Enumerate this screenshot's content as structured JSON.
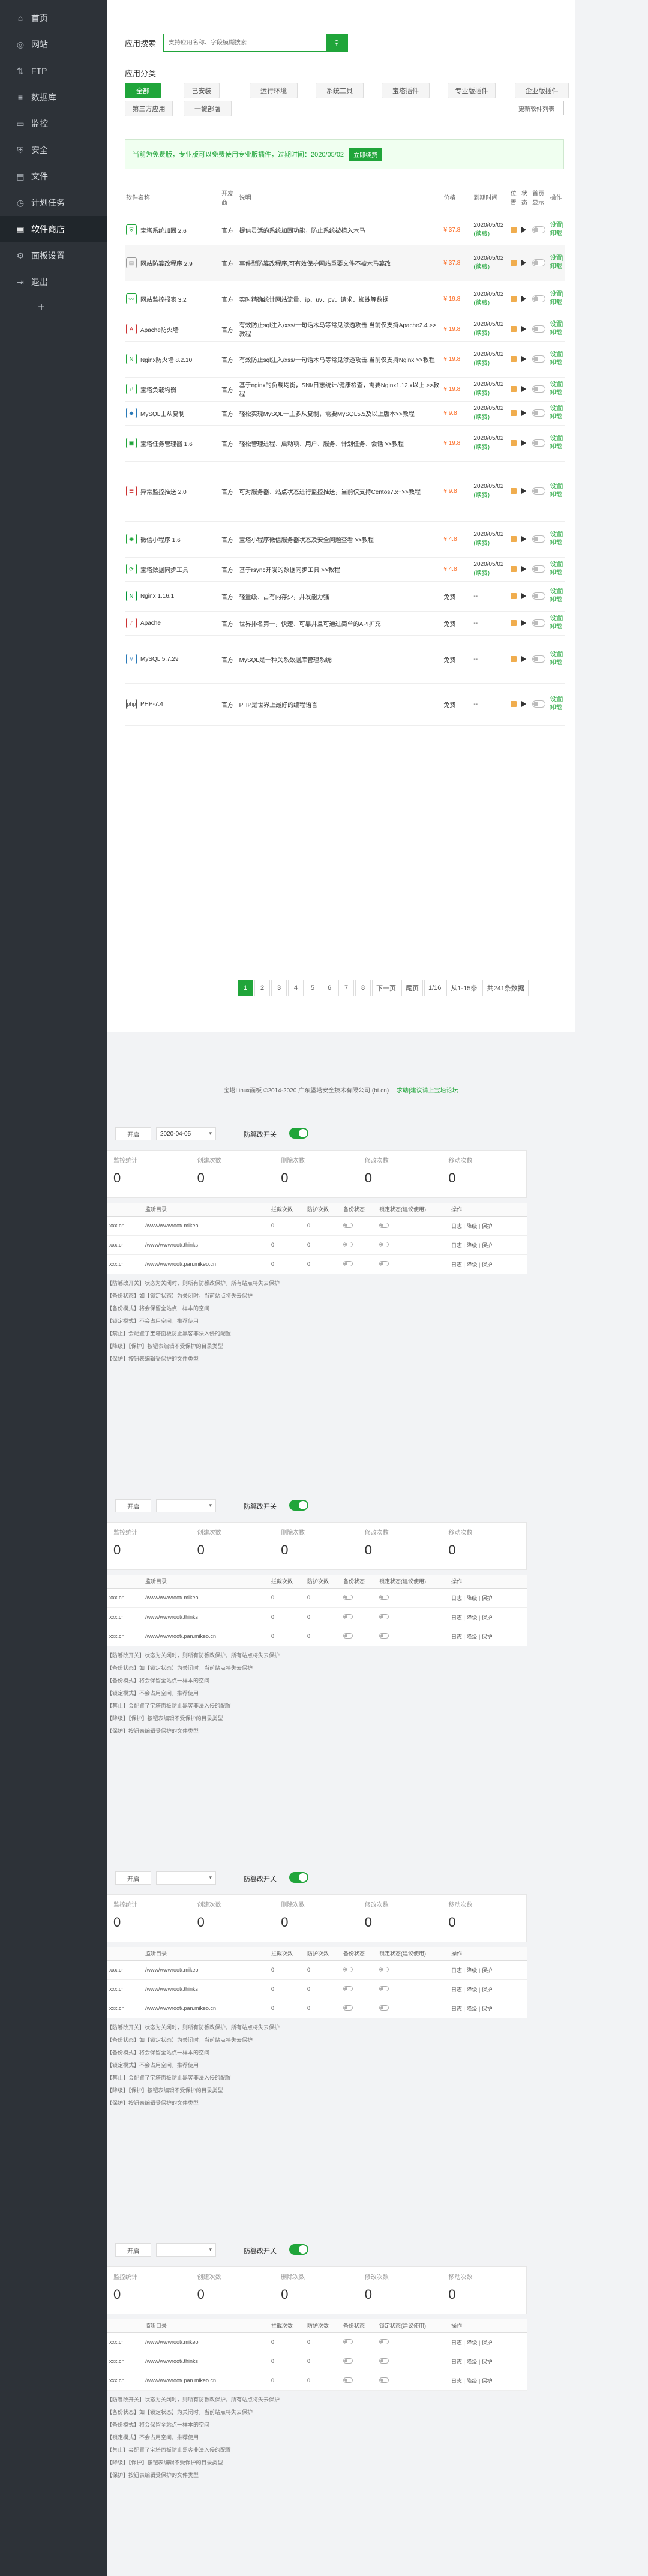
{
  "sidebar": {
    "items": [
      {
        "label": "首页",
        "icon": "home-icon"
      },
      {
        "label": "网站",
        "icon": "globe-icon"
      },
      {
        "label": "FTP",
        "icon": "ftp-icon"
      },
      {
        "label": "数据库",
        "icon": "database-icon"
      },
      {
        "label": "监控",
        "icon": "monitor-icon"
      },
      {
        "label": "安全",
        "icon": "shield-icon"
      },
      {
        "label": "文件",
        "icon": "folder-icon"
      },
      {
        "label": "计划任务",
        "icon": "clock-icon"
      },
      {
        "label": "软件商店",
        "icon": "grid-icon"
      },
      {
        "label": "面板设置",
        "icon": "gear-icon"
      },
      {
        "label": "退出",
        "icon": "logout-icon"
      }
    ],
    "add": "+"
  },
  "store": {
    "search_label": "应用搜索",
    "search_placeholder": "支持应用名称、字段模糊搜索",
    "cat_label": "应用分类",
    "categories": [
      "全部",
      "已安装",
      "运行环境",
      "系统工具",
      "宝塔插件",
      "专业版插件",
      "企业版插件",
      "第三方应用",
      "一键部署"
    ],
    "update_btn": "更新软件列表",
    "notice": "当前为免费版，专业版可以免费使用专业版插件，过期时间：2020/05/02",
    "notice_btn": "立即续费",
    "headers": [
      "软件名称",
      "开发商",
      "说明",
      "价格",
      "到期时间",
      "位置",
      "状态",
      "首页显示",
      "操作"
    ],
    "rows": [
      {
        "name": "宝塔系统加固 2.6",
        "dev": "官方",
        "desc": "提供灵活的系统加固功能，防止系统被植入木马",
        "price": "¥ 37.8",
        "date": "2020/05/02",
        "renew": "(续费)",
        "op": "设置|卸载"
      },
      {
        "name": "网站防篡改程序 2.9",
        "dev": "官方",
        "desc": "事件型防篡改程序,可有效保护网站重要文件不被木马篡改",
        "price": "¥ 37.8",
        "date": "2020/05/02",
        "renew": "(续费)",
        "op": "设置|卸载"
      },
      {
        "name": "网站监控报表 3.2",
        "dev": "官方",
        "desc": "实时精确统计网站流量、ip、uv、pv、请求、蜘蛛等数据",
        "price": "¥ 19.8",
        "date": "2020/05/02",
        "renew": "(续费)",
        "op": "设置|卸载"
      },
      {
        "name": "Apache防火墙",
        "dev": "官方",
        "desc": "有效防止sql注入/xss/一句话木马等常见渗透攻击,当前仅支持Apache2.4 >>教程",
        "price": "¥ 19.8",
        "date": "2020/05/02",
        "renew": "(续费)",
        "op": "设置|卸载"
      },
      {
        "name": "Nginx防火墙 8.2.10",
        "dev": "官方",
        "desc": "有效防止sql注入/xss/一句话木马等常见渗透攻击,当前仅支持Nginx >>教程",
        "price": "¥ 19.8",
        "date": "2020/05/02",
        "renew": "(续费)",
        "op": "设置|卸载"
      },
      {
        "name": "宝塔负载均衡",
        "dev": "官方",
        "desc": "基于nginx的负载均衡，SNI/日志统计/健康检查，需要Nginx1.12.x以上 >>教程",
        "price": "¥ 19.8",
        "date": "2020/05/02",
        "renew": "(续费)",
        "op": "设置|卸载"
      },
      {
        "name": "MySQL主从复制",
        "dev": "官方",
        "desc": "轻松实现MySQL一主多从复制，需要MySQL5.5及以上版本>>教程",
        "price": "¥ 9.8",
        "date": "2020/05/02",
        "renew": "(续费)",
        "op": "设置|卸载"
      },
      {
        "name": "宝塔任务管理器 1.6",
        "dev": "官方",
        "desc": "轻松管理进程、启动项、用户、服务、计划任务、会话 >>教程",
        "price": "¥ 19.8",
        "date": "2020/05/02",
        "renew": "(续费)",
        "op": "设置|卸载"
      },
      {
        "name": "异常监控推送 2.0",
        "dev": "官方",
        "desc": "可对服务器、站点状态进行监控推送，当前仅支持Centos7.x+>>教程",
        "price": "¥ 9.8",
        "date": "2020/05/02",
        "renew": "(续费)",
        "op": "设置|卸载"
      },
      {
        "name": "微信小程序 1.6",
        "dev": "官方",
        "desc": "宝塔小程序微信服务器状态及安全问题查看 >>教程",
        "price": "¥ 4.8",
        "date": "2020/05/02",
        "renew": "(续费)",
        "op": "设置|卸载"
      },
      {
        "name": "宝塔数据同步工具",
        "dev": "官方",
        "desc": "基于rsync开发的数据同步工具 >>教程",
        "price": "¥ 4.8",
        "date": "2020/05/02",
        "renew": "(续费)",
        "op": "设置|卸载"
      },
      {
        "name": "Nginx 1.16.1",
        "dev": "官方",
        "desc": "轻量级、占有内存少，并发能力强",
        "price": "免费",
        "date": "--",
        "renew": "",
        "op": "设置|卸载"
      },
      {
        "name": "Apache",
        "dev": "官方",
        "desc": "世界排名第一，快速、可靠并且可通过简单的API扩充",
        "price": "免费",
        "date": "--",
        "renew": "",
        "op": "设置|卸载"
      },
      {
        "name": "MySQL 5.7.29",
        "dev": "官方",
        "desc": "MySQL是一种关系数据库管理系统!",
        "price": "免费",
        "date": "--",
        "renew": "",
        "op": "设置|卸载"
      },
      {
        "name": "PHP-7.4",
        "dev": "官方",
        "desc": "PHP是世界上最好的编程语言",
        "price": "免费",
        "date": "--",
        "renew": "",
        "op": "设置|卸载"
      }
    ],
    "pager": [
      "1",
      "2",
      "3",
      "4",
      "5",
      "6",
      "7",
      "8",
      "下一页",
      "尾页",
      "1/16",
      "从1-15条",
      "共241条数据"
    ]
  },
  "footer": {
    "copyright": "宝塔Linux面板 ©2014-2020 广东堡塔安全技术有限公司 (bt.cn)",
    "link": "求助|建议请上宝塔论坛"
  },
  "protect": [
    {
      "mini": "开启",
      "sel": "2020-04-05",
      "switch_label": "防篡改开关"
    },
    {
      "mini": "开启",
      "sel": "",
      "switch_label": "防篡改开关"
    },
    {
      "mini": "开启",
      "sel": "",
      "switch_label": "防篡改开关"
    },
    {
      "mini": "开启",
      "sel": "",
      "switch_label": "防篡改开关"
    }
  ],
  "protect_stats": [
    "监控统计",
    "创建次数",
    "删除次数",
    "修改次数",
    "移动次数"
  ],
  "protect_headers": [
    "",
    "监听目录",
    "拦截次数",
    "防护次数",
    "备份状态",
    "锁定状态(建议使用)",
    "操作"
  ],
  "protect_rows": [
    {
      "site": "xxx.cn",
      "path": "/www/wwwroot/.mikeo",
      "ops": "日志 | 降级 | 保护"
    },
    {
      "site": "xxx.cn",
      "path": "/www/wwwroot/.thinks",
      "ops": "日志 | 降级 | 保护"
    },
    {
      "site": "xxx.cn",
      "path": "/www/wwwroot/.pan.mikeo.cn",
      "ops": "日志 | 降级 | 保护"
    }
  ],
  "protect_notes": [
    "【防篡改开关】状态为关闭时，则所有防篡改保护，所有站点将失去保护",
    "【备份状态】如【锁定状态】为关闭时，当前站点将失去保护",
    "【备份模式】将会保留全站点一样本的空间",
    "【锁定模式】不会占用空间，推荐使用",
    "【禁止】会配置了宝塔面板防止黑客非法入侵的配置",
    "【降级】【保护】按钮表编辑不受保护的目录类型",
    "【保护】按钮表编辑受保护的文件类型"
  ]
}
